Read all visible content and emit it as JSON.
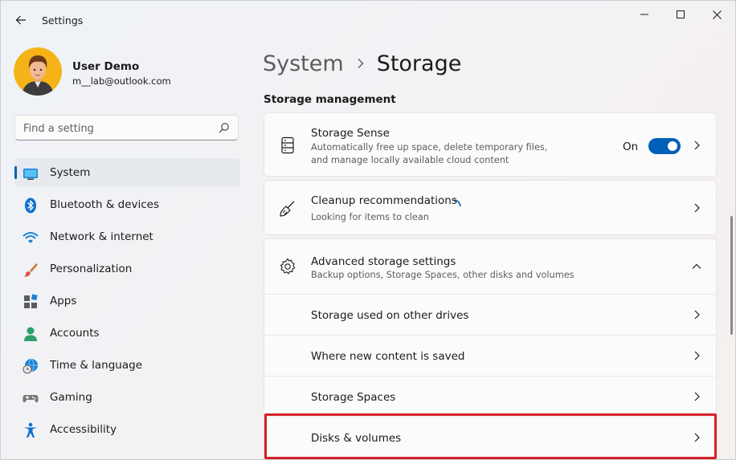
{
  "window": {
    "title": "Settings"
  },
  "user": {
    "name": "User Demo",
    "email": "m__lab@outlook.com"
  },
  "search": {
    "placeholder": "Find a setting"
  },
  "nav": {
    "items": [
      {
        "label": "System",
        "icon": "system-icon",
        "active": true
      },
      {
        "label": "Bluetooth & devices",
        "icon": "bluetooth-icon"
      },
      {
        "label": "Network & internet",
        "icon": "network-icon"
      },
      {
        "label": "Personalization",
        "icon": "brush-icon"
      },
      {
        "label": "Apps",
        "icon": "apps-icon"
      },
      {
        "label": "Accounts",
        "icon": "accounts-icon"
      },
      {
        "label": "Time & language",
        "icon": "globe-clock-icon"
      },
      {
        "label": "Gaming",
        "icon": "gamepad-icon"
      },
      {
        "label": "Accessibility",
        "icon": "accessibility-icon"
      }
    ]
  },
  "breadcrumb": {
    "parent": "System",
    "current": "Storage"
  },
  "main": {
    "section_title": "Storage management",
    "storage_sense": {
      "title": "Storage Sense",
      "desc_line1": "Automatically free up space, delete temporary files,",
      "desc_line2": "and manage locally available cloud content",
      "toggle_label": "On",
      "toggle_on": true
    },
    "cleanup": {
      "title": "Cleanup recommendations",
      "desc": "Looking for items to clean"
    },
    "advanced": {
      "title": "Advanced storage settings",
      "desc": "Backup options, Storage Spaces, other disks and volumes",
      "expanded": true,
      "sub_items": [
        {
          "label": "Storage used on other drives"
        },
        {
          "label": "Where new content is saved"
        },
        {
          "label": "Storage Spaces"
        },
        {
          "label": "Disks & volumes",
          "highlighted": true
        }
      ]
    }
  },
  "colors": {
    "accent": "#005fb8",
    "highlight": "#d4202a"
  }
}
